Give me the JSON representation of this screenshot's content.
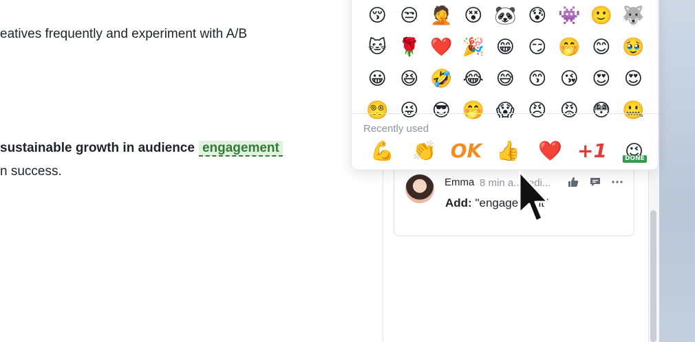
{
  "document": {
    "line1": "eatives frequently and experiment with A/B",
    "line2_prefix": "sustainable growth in audience",
    "highlight_word": "engagement",
    "line3": "n success."
  },
  "emoji_picker": {
    "grid_rows": [
      [
        "😚",
        "😒",
        "🤦",
        "😵",
        "🐼",
        "😰",
        "👾",
        "🙂",
        "🐺"
      ],
      [
        "🐱",
        "🌹",
        "❤️",
        "🎉",
        "😁",
        "😏",
        "🤭",
        "😊",
        "🥹"
      ],
      [
        "😀",
        "😆",
        "🤣",
        "😂",
        "😅",
        "😙",
        "😘",
        "😍",
        "😍"
      ],
      [
        "😵‍💫",
        "😜",
        "😎",
        "🤭",
        "😱",
        "😠",
        "😡",
        "😳",
        "🤐"
      ]
    ],
    "recent_label": "Recently used",
    "recent": {
      "muscle": "💪",
      "clap": "👏",
      "ok": "OK",
      "thumbs": "👍",
      "heart": "❤️",
      "plus_one": "+1",
      "done_face": "😉",
      "done_text": "DONE"
    }
  },
  "comment": {
    "author": "Emma",
    "meta": "8 min a... (edi...",
    "body_label": "Add:",
    "body_value": "\"engagement\"",
    "icons": [
      "thumbs-up-icon",
      "reply-icon",
      "more-icon"
    ]
  }
}
